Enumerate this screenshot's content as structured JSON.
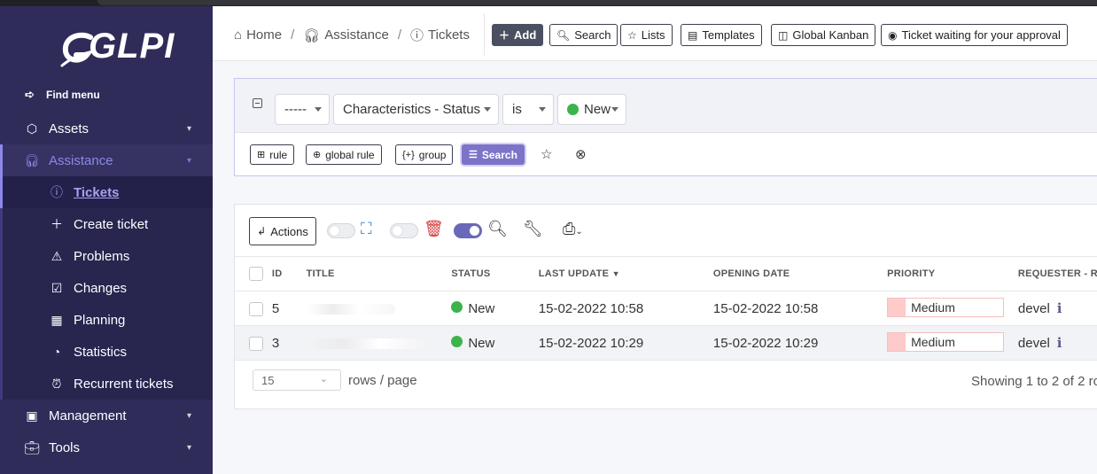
{
  "app": {
    "logo_text": "GLPI"
  },
  "sidebar": {
    "find_menu": "Find menu",
    "items": [
      {
        "label": "Assets",
        "icon": "box-icon"
      },
      {
        "label": "Assistance",
        "icon": "headset-icon",
        "active": true
      },
      {
        "label": "Management",
        "icon": "wallet-icon"
      },
      {
        "label": "Tools",
        "icon": "briefcase-icon"
      }
    ],
    "submenu": [
      {
        "label": "Tickets",
        "icon": "alert-circle-icon",
        "current": true
      },
      {
        "label": "Create ticket",
        "icon": "plus-icon"
      },
      {
        "label": "Problems",
        "icon": "warning-triangle-icon"
      },
      {
        "label": "Changes",
        "icon": "clipboard-check-icon"
      },
      {
        "label": "Planning",
        "icon": "calendar-icon"
      },
      {
        "label": "Statistics",
        "icon": "pie-chart-icon"
      },
      {
        "label": "Recurrent tickets",
        "icon": "alarm-icon"
      }
    ]
  },
  "breadcrumb": {
    "home": "Home",
    "assistance": "Assistance",
    "tickets": "Tickets"
  },
  "toolbar": {
    "add": "Add",
    "search": "Search",
    "lists": "Lists",
    "templates": "Templates",
    "kanban": "Global Kanban",
    "waiting": "Ticket waiting for your approval"
  },
  "criteria": {
    "link": "-----",
    "field": "Characteristics - Status",
    "operator": "is",
    "value": "New",
    "value_color": "#3cb44b",
    "btn_rule": "rule",
    "btn_global_rule": "global rule",
    "btn_group": "group",
    "btn_search": "Search"
  },
  "results": {
    "actions_label": "Actions",
    "columns": [
      "ID",
      "TITLE",
      "STATUS",
      "LAST UPDATE",
      "OPENING DATE",
      "PRIORITY",
      "REQUESTER - R"
    ],
    "rows": [
      {
        "id": "5",
        "status": "New",
        "last_update": "15-02-2022 10:58",
        "opening_date": "15-02-2022 10:58",
        "priority": "Medium",
        "requester": "devel"
      },
      {
        "id": "3",
        "status": "New",
        "last_update": "15-02-2022 10:29",
        "opening_date": "15-02-2022 10:29",
        "priority": "Medium",
        "requester": "devel"
      }
    ],
    "rows_per_page": "15",
    "rows_per_page_label": "rows / page",
    "showing": "Showing 1 to 2 of 2 ro"
  },
  "colors": {
    "sidebar_bg": "#2f2c59",
    "accent": "#8d88e8",
    "priority_medium": "#ffcaca",
    "status_new": "#3cb44b"
  }
}
